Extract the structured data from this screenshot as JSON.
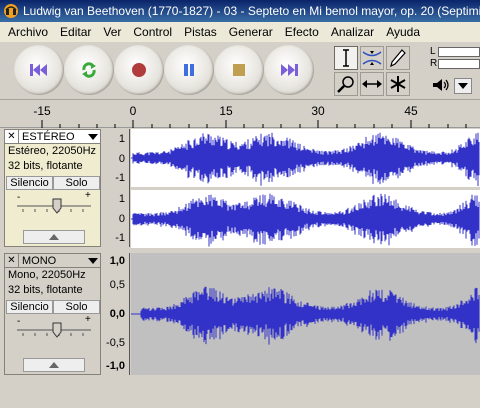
{
  "window": {
    "title": "Ludwig van Beethoven (1770-1827) - 03 - Septeto en Mi bemol mayor, op. 20 (Septimi"
  },
  "menu": [
    "Archivo",
    "Editar",
    "Ver",
    "Control",
    "Pistas",
    "Generar",
    "Efecto",
    "Analizar",
    "Ayuda"
  ],
  "meters": {
    "left_label": "L",
    "right_label": "R"
  },
  "ruler": {
    "ticks": [
      "-15",
      "0",
      "15",
      "30",
      "45"
    ]
  },
  "tracks": {
    "stereo": {
      "name": "ESTÉREO",
      "info_line1": "Estéreo, 22050Hz",
      "info_line2": "32 bits, flotante",
      "mute_label": "Silencio",
      "solo_label": "Solo",
      "gain_minus": "-",
      "gain_plus": "+",
      "scale_top": [
        "1",
        "0",
        "-1"
      ],
      "scale_bottom": [
        "1",
        "0",
        "-1"
      ]
    },
    "mono": {
      "name": "MONO",
      "info_line1": "Mono, 22050Hz",
      "info_line2": "32 bits, flotante",
      "mute_label": "Silencio",
      "solo_label": "Solo",
      "gain_minus": "-",
      "gain_plus": "+",
      "scale": [
        "1,0",
        "0,5",
        "0,0",
        "-0,5",
        "-1,0"
      ]
    }
  },
  "colors": {
    "waveform": "#3232c8",
    "wave_background_selected": "#ffffff",
    "wave_background": "#c0c0c0",
    "title_bar": "#0a246a"
  },
  "icons": {
    "transport": [
      "skip-start-icon",
      "loop-play-icon",
      "record-icon",
      "pause-icon",
      "stop-icon",
      "skip-end-icon"
    ],
    "tools": [
      "selection-tool-icon",
      "envelope-tool-icon",
      "draw-tool-icon",
      "zoom-tool-icon",
      "timeshift-tool-icon",
      "multi-tool-icon"
    ]
  }
}
